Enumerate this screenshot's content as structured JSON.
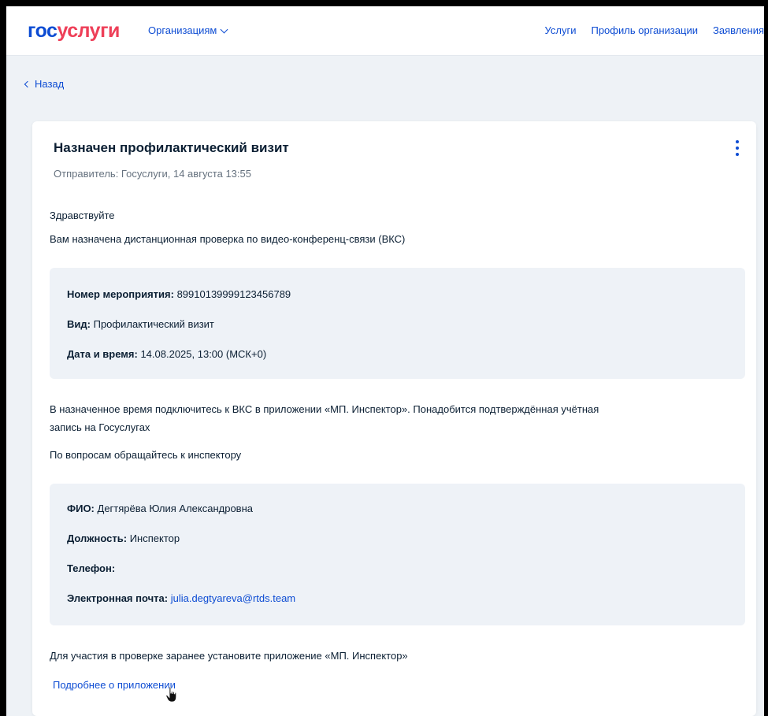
{
  "header": {
    "logo_part1": "гос",
    "logo_part2": "услуги",
    "org_menu_label": "Организациям",
    "nav": [
      "Услуги",
      "Профиль организации",
      "Заявления"
    ]
  },
  "back_label": "Назад",
  "message": {
    "title": "Назначен профилактический визит",
    "sender": "Отправитель: Госуслуги, 14 августа 13:55",
    "greeting": "Здравствуйте",
    "intro": "Вам назначена дистанционная проверка по видео-конференц-связи (ВКС)",
    "event": {
      "number_label": "Номер мероприятия:",
      "number_value": "89910139999123456789",
      "type_label": "Вид:",
      "type_value": "Профилактический визит",
      "datetime_label": "Дата и время:",
      "datetime_value": "14.08.2025, 13:00 (МСК+0)"
    },
    "instructions_line1": "В назначенное время подключитесь к ВКС в приложении «МП. Инспектор». Понадобится подтверждённая учётная",
    "instructions_line2": "запись на Госуслугах",
    "contact_prompt": "По вопросам обращайтесь к инспектору",
    "inspector": {
      "name_label": "ФИО:",
      "name_value": "Дегтярёва Юлия Александровна",
      "position_label": "Должность:",
      "position_value": "Инспектор",
      "phone_label": "Телефон:",
      "phone_value": "",
      "email_label": "Электронная почта:",
      "email_value": "julia.degtyareva@rtds.team"
    },
    "install_note": "Для участия в проверке заранее установите приложение «МП. Инспектор»",
    "more_link": "Подробнее о приложении"
  },
  "colors": {
    "accent": "#0d4cd3",
    "brand_red": "#ee3f58",
    "text": "#0b1f33",
    "muted": "#66727f",
    "info_bg": "#eef2f7",
    "page_bg": "#eef2f6"
  },
  "icons": [
    "chevron-down-icon",
    "chevron-left-icon",
    "more-vertical-icon",
    "hand-cursor-icon"
  ]
}
